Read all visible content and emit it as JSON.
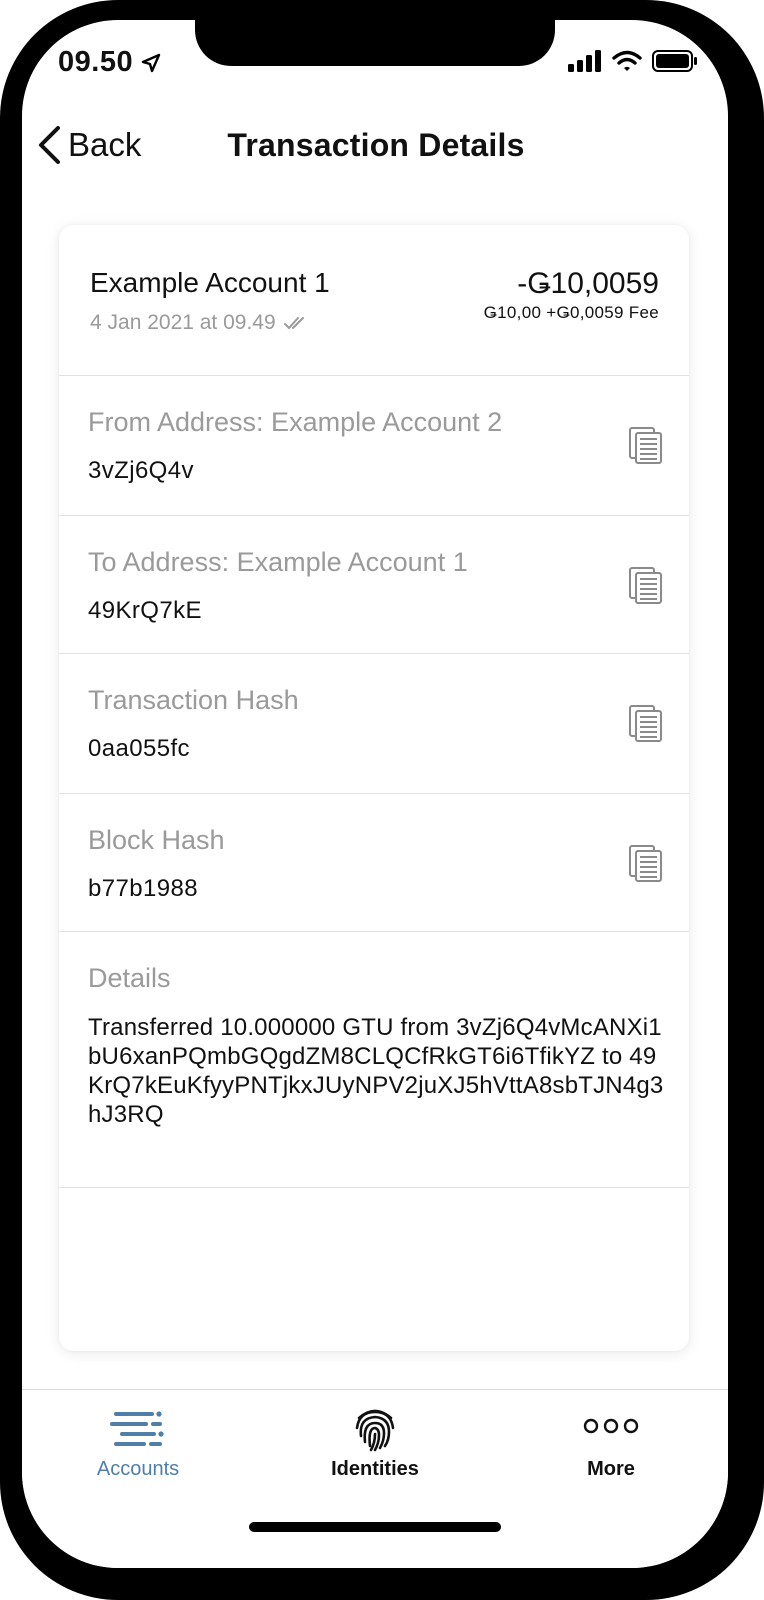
{
  "status": {
    "time": "09.50"
  },
  "nav": {
    "back_label": "Back",
    "title": "Transaction Details"
  },
  "summary": {
    "account_name": "Example Account 1",
    "date": "4 Jan 2021 at 09.49",
    "amount": "-Ǥ10,0059",
    "fee": "Ǥ10,00 +Ǥ0,0059 Fee"
  },
  "fields": [
    {
      "label": "From Address: Example Account 2",
      "value": "3vZj6Q4v"
    },
    {
      "label": "To Address: Example Account 1",
      "value": "49KrQ7kE"
    },
    {
      "label": "Transaction Hash",
      "value": "0aa055fc"
    },
    {
      "label": "Block Hash",
      "value": "b77b1988"
    }
  ],
  "details": {
    "label": "Details",
    "text": "Transferred 10.000000 GTU from 3vZj6Q4vMcANXi1bU6xanPQmbGQgdZM8CLQCfRkGT6i6TfikYZ to 49KrQ7kEuKfyyPNTjkxJUyNPV2juXJ5hVttA8sbTJN4g3hJ3RQ"
  },
  "tabs": [
    {
      "label": "Accounts",
      "icon": "accounts-list-icon",
      "active": true
    },
    {
      "label": "Identities",
      "icon": "fingerprint-icon",
      "active": false
    },
    {
      "label": "More",
      "icon": "more-dots-icon",
      "active": false
    }
  ],
  "colors": {
    "accent": "#4f7fa8",
    "muted": "#9a9a9a",
    "text": "#111111"
  }
}
